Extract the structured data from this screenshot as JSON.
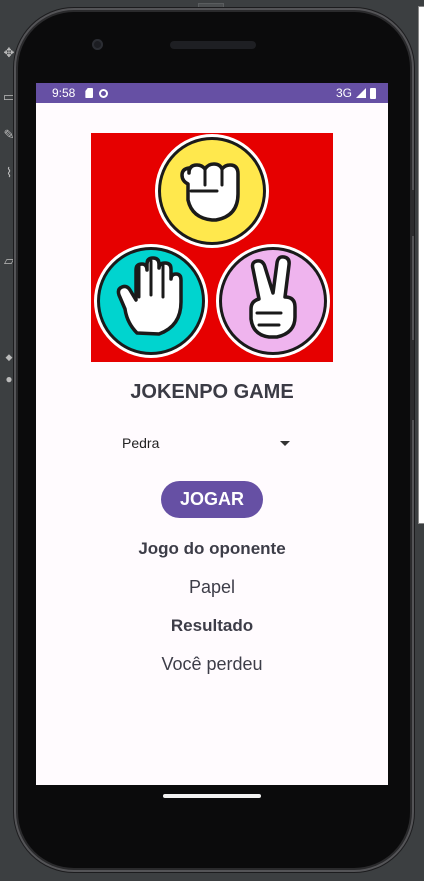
{
  "status_bar": {
    "time": "9:58",
    "network": "3G"
  },
  "hero_image": {
    "alt": "rock-paper-scissors hands",
    "bg_color": "#e60000",
    "colors": {
      "rock": "#ffe84d",
      "paper": "#00d4cf",
      "scissors": "#efb4ee"
    }
  },
  "app": {
    "title": "JOKENPO GAME",
    "choice_select": {
      "value": "Pedra"
    },
    "play_button": "JOGAR",
    "opponent_heading": "Jogo do oponente",
    "opponent_value": "Papel",
    "result_heading": "Resultado",
    "result_value": "Você perdeu"
  },
  "accent_color": "#6650a4"
}
